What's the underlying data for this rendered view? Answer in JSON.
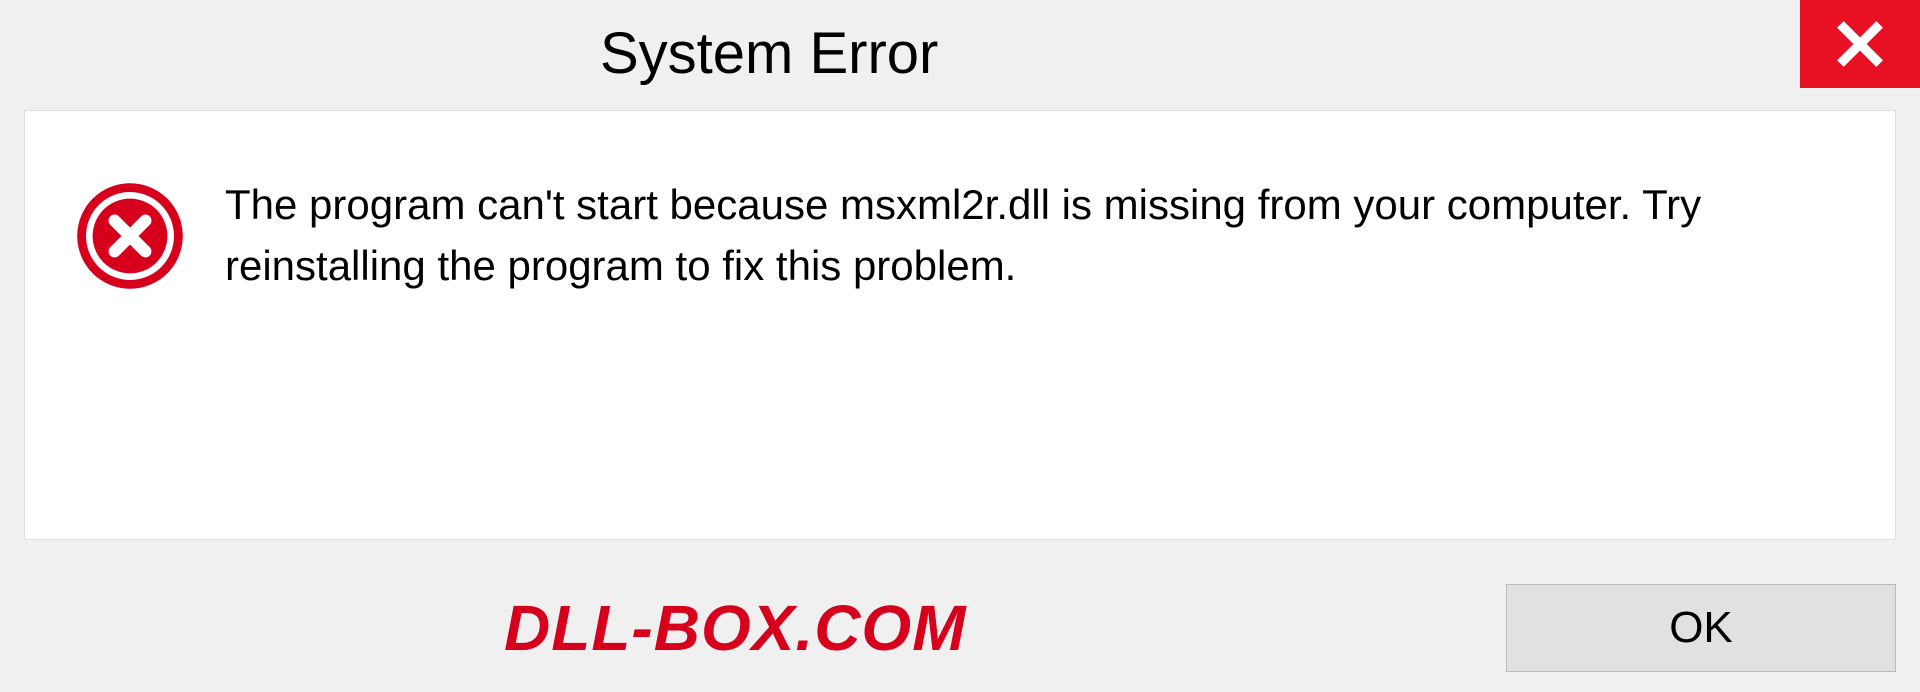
{
  "titlebar": {
    "title": "System Error"
  },
  "dialog": {
    "message": "The program can't start because msxml2r.dll is missing from your computer. Try reinstalling the program to fix this problem."
  },
  "footer": {
    "watermark": "DLL-BOX.COM",
    "ok_label": "OK"
  },
  "colors": {
    "close_bg": "#e81123",
    "error_red": "#d6001c"
  }
}
